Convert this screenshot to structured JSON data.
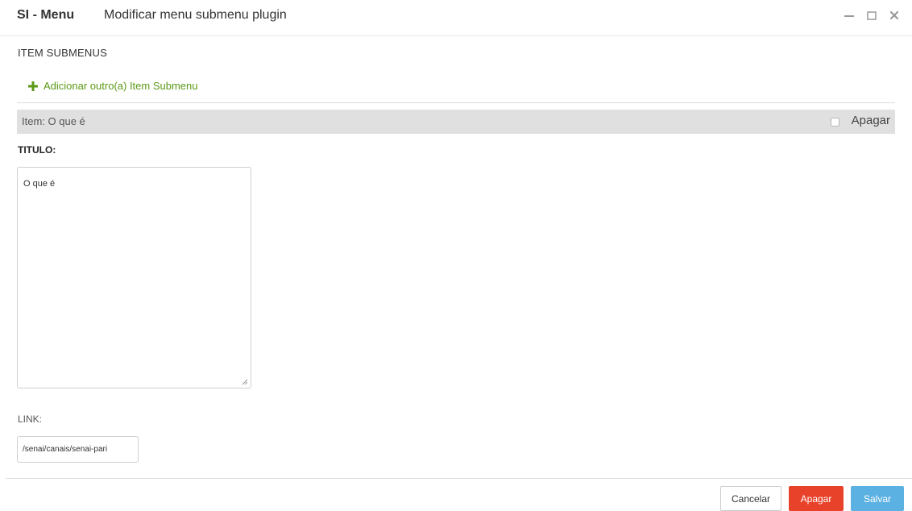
{
  "window": {
    "app_name": "SI - Menu",
    "dialog_title": "Modificar menu submenu plugin",
    "controls": [
      "minimize-icon",
      "maximize-icon",
      "close-icon"
    ]
  },
  "section": {
    "heading": "ITEM SUBMENUS",
    "add_link_label": "Adicionar outro(a) Item Submenu"
  },
  "item": {
    "label": "Item: O que é",
    "delete_checkbox_checked": false,
    "delete_label": "Apagar"
  },
  "fields": {
    "titulo_label": "TITULO:",
    "titulo_value": "O que é",
    "link_label": "LINK:",
    "link_value": "/senai/canais/senai-pari"
  },
  "footer": {
    "cancel_label": "Cancelar",
    "delete_label": "Apagar",
    "save_label": "Salvar"
  },
  "colors": {
    "add_link": "#5b9a16",
    "delete_button": "#e8422b",
    "save_button": "#5bb1e2",
    "item_bar": "#e0e0e0"
  }
}
